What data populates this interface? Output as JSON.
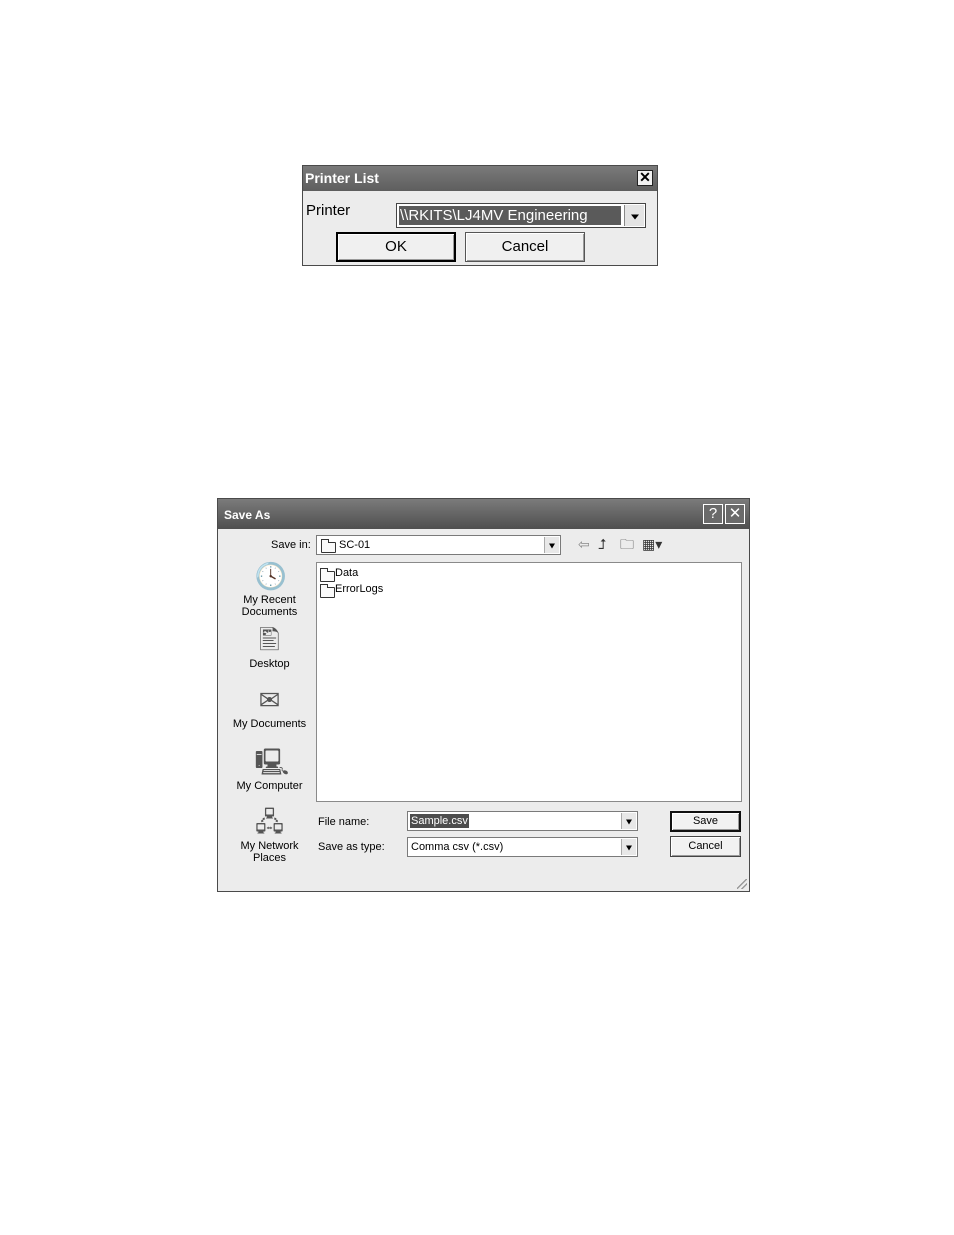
{
  "printer_dialog": {
    "title": "Printer List",
    "printer_label": "Printer",
    "printer_value": "\\\\RKITS\\LJ4MV Engineering",
    "ok_label": "OK",
    "cancel_label": "Cancel",
    "close_glyph": "✕"
  },
  "save_dialog": {
    "title": "Save As",
    "help_glyph": "?",
    "close_glyph": "✕",
    "save_in_label": "Save in:",
    "save_in_value": "SC-01",
    "toolbar": {
      "back_icon": "back-arrow-icon",
      "up_icon": "up-folder-icon",
      "new_folder_icon": "new-folder-icon",
      "views_icon": "views-menu-icon"
    },
    "places": [
      {
        "label": "My Recent Documents",
        "icon": "recent-documents-icon"
      },
      {
        "label": "Desktop",
        "icon": "desktop-icon"
      },
      {
        "label": "My Documents",
        "icon": "my-documents-icon"
      },
      {
        "label": "My Computer",
        "icon": "my-computer-icon"
      },
      {
        "label": "My Network Places",
        "icon": "network-places-icon"
      }
    ],
    "files": [
      {
        "name": "Data",
        "type": "folder"
      },
      {
        "name": "ErrorLogs",
        "type": "folder"
      }
    ],
    "file_name_label": "File name:",
    "file_name_value": "Sample.csv",
    "save_as_type_label": "Save as type:",
    "save_as_type_value": "Comma csv (*.csv)",
    "save_label": "Save",
    "cancel_label": "Cancel"
  }
}
